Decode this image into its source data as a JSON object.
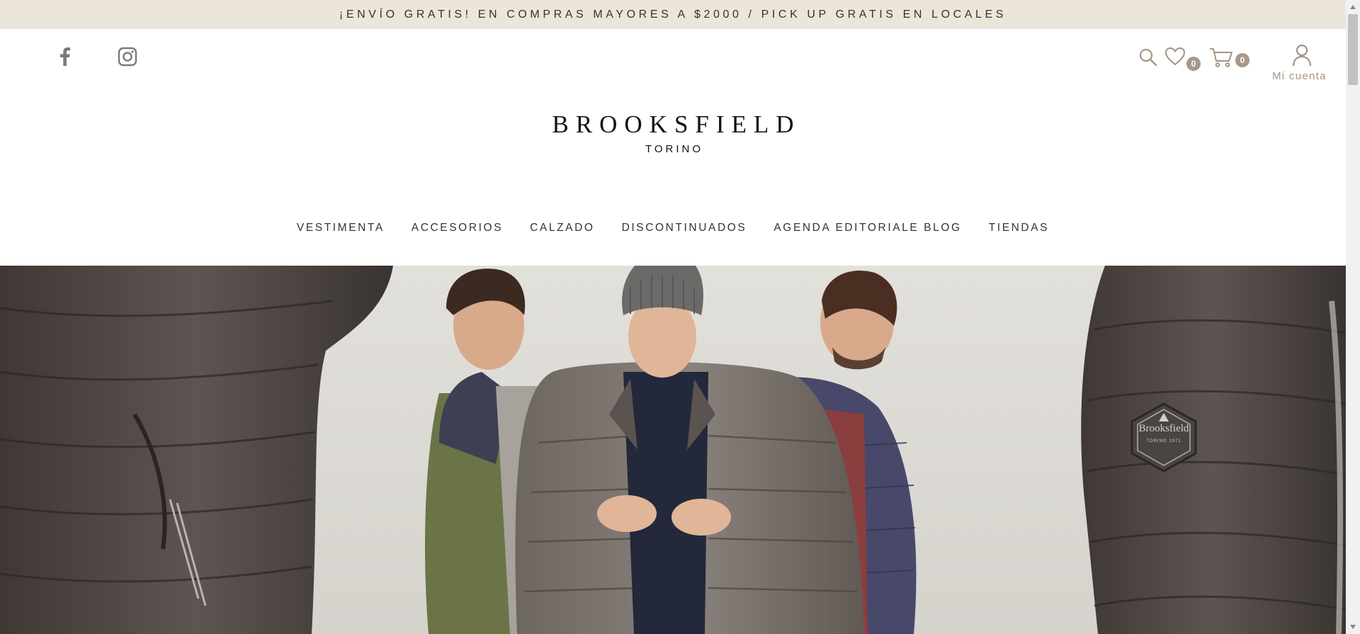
{
  "announcement": {
    "text": "¡ENVÍO GRATIS! EN COMPRAS MAYORES A $2000 / PICK UP GRATIS EN LOCALES"
  },
  "social": [
    {
      "name": "facebook-icon"
    },
    {
      "name": "instagram-icon"
    }
  ],
  "header": {
    "wishlist_count": "0",
    "cart_count": "0",
    "account_label": "Mi cuenta"
  },
  "logo": {
    "main": "BROOKSFIELD",
    "sub": "TORINO"
  },
  "nav": {
    "items": [
      {
        "label": "VESTIMENTA"
      },
      {
        "label": "ACCESORIOS"
      },
      {
        "label": "CALZADO"
      },
      {
        "label": "DISCONTINUADOS"
      },
      {
        "label": "AGENDA EDITORIALE BLOG"
      },
      {
        "label": "TIENDAS"
      }
    ]
  },
  "hero": {
    "patch_text": "Brooksfield",
    "patch_subtext": "TORINO 1971"
  },
  "colors": {
    "announcement_bg": "#ece5d9",
    "accent": "#a89380",
    "badge": "#a89887",
    "hero_bg": "#dedcd7"
  }
}
